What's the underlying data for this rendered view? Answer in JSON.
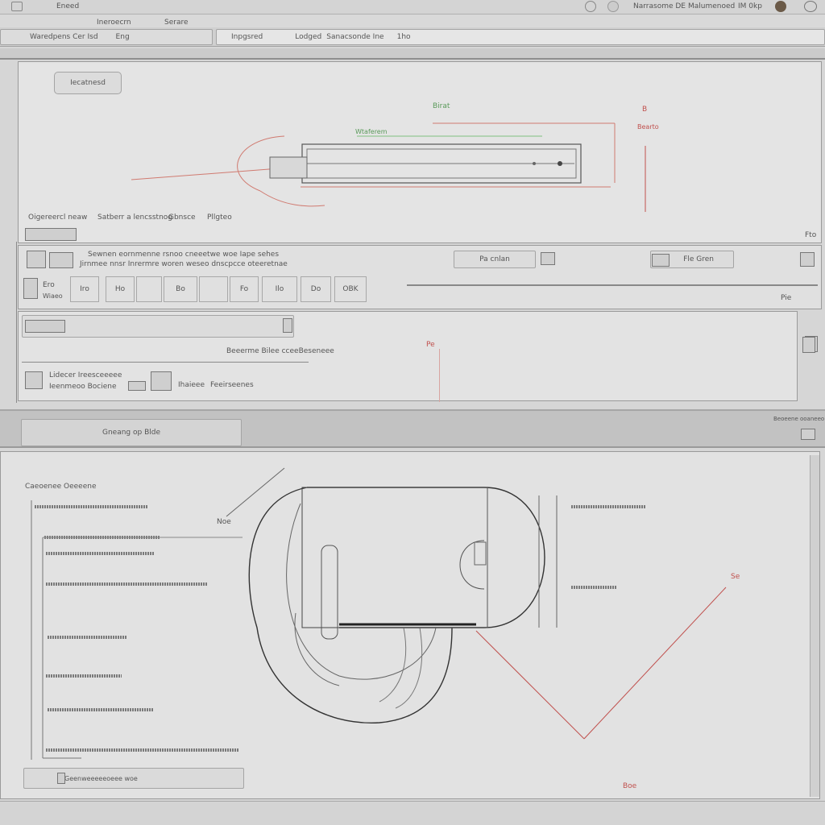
{
  "menubar": {
    "left_item": "Eneed",
    "right_label_1": "Narrasome DE",
    "right_label_2": "Malumenoed",
    "right_label_3": "IM 0kp",
    "tab_top_1": "Ineroecrn",
    "tab_top_2": "Serare"
  },
  "tabbar": {
    "tab_1": "Waredpens Cer Isd",
    "tab_1_extra": "Eng",
    "tab_2": "Inpgsred",
    "tab_2_extra": "Lodged",
    "tab_2_extra_2": "Sanacsonde Ine",
    "tab_2_num": "1ho"
  },
  "top_view": {
    "view_button": "Iecatnesd",
    "green_label": "Birat",
    "green_label_2": "Wtaferem",
    "red_label_1": "B",
    "red_label_2": "Bearto",
    "row_text_1": "Oigereercl neaw",
    "row_text_2": "Satberr a lencsstnog",
    "row_text_3": "Gbnsce",
    "row_text_4": "Pllgteo",
    "corner_label": "Fto"
  },
  "toolbar": {
    "row1_text": "Sewnen eornmenne rsnoo cneeetwe woe Iape sehes",
    "row1_text_2": "Jirnmee nnsr Inrermre woren weseo dnscpcce oteeretnae",
    "field_label": "Pa cnlan",
    "right_label": "Fle Gren",
    "tools": [
      "Iro",
      "Ho",
      "",
      "Bo",
      "",
      "Fo",
      "Ilo",
      "Do",
      "OBK"
    ],
    "tool_left_label": "Ero",
    "tool_left_label_2": "Wiaeo",
    "side_label": "Pie"
  },
  "properties": {
    "center_text": "Beeerme Bilee cceeBeseneee",
    "red_mark": "Pe",
    "left_text_1": "Lidecer Ireesceeeee",
    "left_text_2": "Ieenmeoo Bociene",
    "mid_text_1": "Ihaieee",
    "mid_text_2": "Feeirseenes",
    "right_icon": "Dto"
  },
  "status_bar": {
    "button": "Gneang op Blde",
    "right_label": "Beoeene ooaneeo"
  },
  "bottom_view": {
    "label_top": "Caeoenee Oeeeene",
    "label_a": "Noe",
    "red_label_1": "Se",
    "red_label_2": "Boe",
    "footer_field": "Geenweeeeeoeee woe"
  }
}
